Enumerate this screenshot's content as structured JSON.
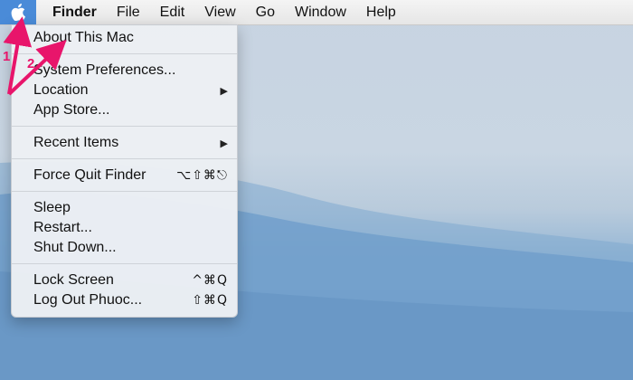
{
  "menubar": {
    "apple_icon": "apple-logo",
    "items": [
      "Finder",
      "File",
      "Edit",
      "View",
      "Go",
      "Window",
      "Help"
    ]
  },
  "apple_menu": {
    "about": "About This Mac",
    "system_preferences": "System Preferences...",
    "location": "Location",
    "app_store": "App Store...",
    "recent_items": "Recent Items",
    "force_quit": "Force Quit Finder",
    "force_quit_shortcut": "⌥⇧⌘⎋",
    "sleep": "Sleep",
    "restart": "Restart...",
    "shut_down": "Shut Down...",
    "lock_screen": "Lock Screen",
    "lock_screen_shortcut": "^⌘Q",
    "log_out": "Log Out Phuoc...",
    "log_out_shortcut": "⇧⌘Q",
    "submenu_icon": "triangle-right"
  },
  "annotations": {
    "step1": "1",
    "step2": "2",
    "color": "#e8156b"
  },
  "colors": {
    "apple_highlight": "#4a8bd8"
  }
}
